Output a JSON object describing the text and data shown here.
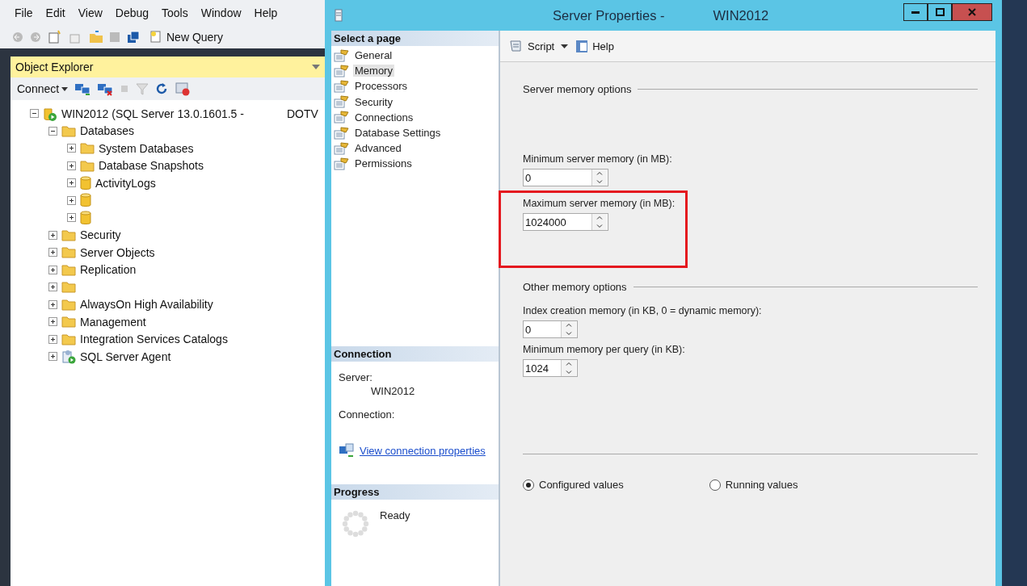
{
  "menu": [
    "File",
    "Edit",
    "View",
    "Debug",
    "Tools",
    "Window",
    "Help"
  ],
  "toolbar": {
    "new_query": "New Query"
  },
  "object_explorer": {
    "title": "Object Explorer",
    "connect": "Connect",
    "tree": [
      {
        "kind": "server",
        "label": "WIN2012 (SQL Server 13.0.1601.5 -",
        "label_tail": "DOTV",
        "expanded": true,
        "children": [
          {
            "kind": "folder",
            "label": "Databases",
            "expanded": true,
            "children": [
              {
                "kind": "folder",
                "label": "System Databases",
                "expanded": false
              },
              {
                "kind": "folder",
                "label": "Database Snapshots",
                "expanded": false
              },
              {
                "kind": "database",
                "label": "ActivityLogs",
                "expanded": false
              },
              {
                "kind": "database",
                "expanded": false
              },
              {
                "kind": "database",
                "expanded": false
              }
            ]
          },
          {
            "kind": "folder",
            "label": "Security",
            "expanded": false
          },
          {
            "kind": "folder",
            "label": "Server Objects",
            "expanded": false
          },
          {
            "kind": "folder",
            "label": "Replication",
            "expanded": false
          },
          {
            "kind": "folder",
            "expanded": false
          },
          {
            "kind": "folder",
            "label": "AlwaysOn High Availability",
            "expanded": false
          },
          {
            "kind": "folder",
            "label": "Management",
            "expanded": false
          },
          {
            "kind": "folder",
            "label": "Integration Services Catalogs",
            "expanded": false
          },
          {
            "kind": "agent",
            "label": "SQL Server Agent",
            "expanded": false
          }
        ]
      }
    ]
  },
  "dialog": {
    "title": "Server Properties -",
    "title_server": "WIN2012",
    "select_page": {
      "heading": "Select a page",
      "pages": [
        {
          "label": "General",
          "selected": false
        },
        {
          "label": "Memory",
          "selected": true
        },
        {
          "label": "Processors",
          "selected": false
        },
        {
          "label": "Security",
          "selected": false
        },
        {
          "label": "Connections",
          "selected": false
        },
        {
          "label": "Database Settings",
          "selected": false
        },
        {
          "label": "Advanced",
          "selected": false
        },
        {
          "label": "Permissions",
          "selected": false
        }
      ]
    },
    "connection": {
      "heading": "Connection",
      "server_label": "Server:",
      "server": "WIN2012",
      "connection_label": "Connection:",
      "link": "View connection properties"
    },
    "progress": {
      "heading": "Progress",
      "status": "Ready"
    },
    "toolbar": {
      "script": "Script",
      "help": "Help"
    },
    "sections": [
      {
        "title": "Server memory options",
        "fields": [
          {
            "label": "Minimum server memory (in MB):",
            "value": "0",
            "highlighted": false
          },
          {
            "label": "Maximum server memory (in MB):",
            "value": "1024000",
            "highlighted": true
          }
        ]
      },
      {
        "title": "Other memory options",
        "fields": [
          {
            "label": "Index creation memory (in KB, 0 = dynamic memory):",
            "value": "0",
            "highlighted": false
          },
          {
            "label": "Minimum memory per query (in KB):",
            "value": "1024",
            "highlighted": false
          }
        ]
      }
    ],
    "radios": [
      {
        "label": "Configured values",
        "selected": true
      },
      {
        "label": "Running values",
        "selected": false
      }
    ]
  }
}
